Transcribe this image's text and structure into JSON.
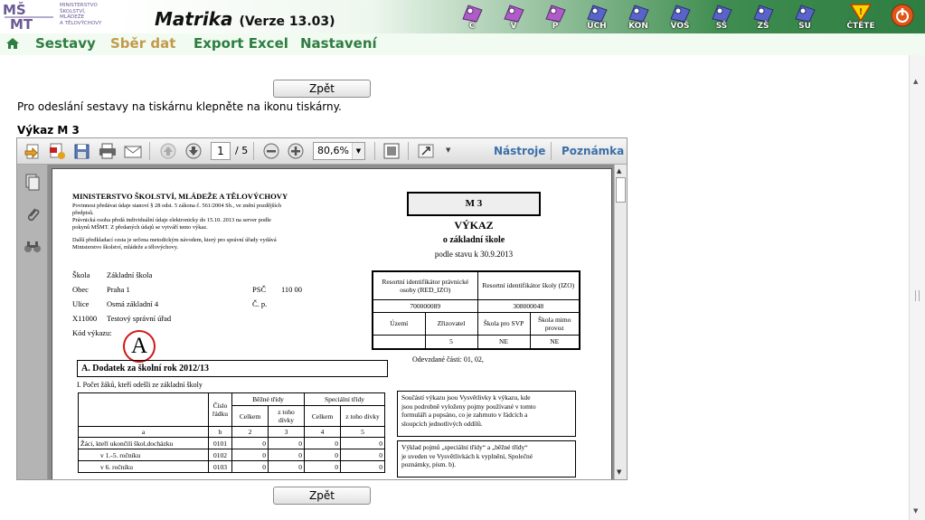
{
  "header": {
    "logo_lines": [
      "MINISTERSTVO",
      "ŠKOLSTVÍ,",
      "MLÁDEŽE",
      "A TĚLOVÝCHOVY"
    ],
    "app_name": "Matrika",
    "app_version": "(Verze 13.03)",
    "icons": [
      {
        "label": "C",
        "name": "module-c-icon"
      },
      {
        "label": "V",
        "name": "module-v-icon"
      },
      {
        "label": "P",
        "name": "module-p-icon"
      },
      {
        "label": "UCH",
        "name": "module-uch-icon"
      },
      {
        "label": "KON",
        "name": "module-kon-icon"
      },
      {
        "label": "VOŠ",
        "name": "module-vos-icon"
      },
      {
        "label": "SŠ",
        "name": "module-ss-icon"
      },
      {
        "label": "ZŠ",
        "name": "module-zs-icon"
      },
      {
        "label": "SU",
        "name": "module-su-icon"
      }
    ],
    "read_label": "ČTĚTE"
  },
  "menu": {
    "items": [
      "Sestavy",
      "Sběr dat",
      "Export Excel",
      "Nastavení"
    ],
    "active": "Sběr dat"
  },
  "content": {
    "back_label": "Zpět",
    "info_text": "Pro odeslání sestavy na tiskárnu klepněte na ikonu tiskárny.",
    "report_title": "Výkaz M 3"
  },
  "viewer": {
    "page_current": "1",
    "page_total": "/ 5",
    "zoom": "80,6%",
    "tools_label": "Nástroje",
    "notes_label": "Poznámka"
  },
  "document": {
    "ministry": "MINISTERSTVO ŠKOLSTVÍ, MLÁDEŽE A TĚLOVÝCHOVY",
    "note_lines": [
      "Povinnost předávat údaje stanoví § 28 odst. 5 zákona č. 561/2004 Sb., ve znění pozdějších",
      "předpisů.",
      "Právnická osoba předá individuální údaje elektronicky do 15.10. 2013 na server podle",
      "pokynů MŠMT. Z předaných údajů se vytváří tento výkaz.",
      "",
      "Další předkladací cesta je určena metodickým návodem, který pro správní úřady vydává",
      "Ministerstvo školství, mládeže a tělovýchovy."
    ],
    "school_label": "Škola",
    "school_value": "Základní škola",
    "town_label": "Obec",
    "town_value": "Praha 1",
    "psc_label": "PSČ",
    "psc_value": "110 00",
    "street_label": "Ulice",
    "street_value": "Osmá základní 4",
    "cp_label": "Č. p.",
    "office_code": "X11000",
    "office_value": "Testový správní úřad",
    "report_code_label": "Kód výkazu:",
    "stamp": "A",
    "form_code": "M 3",
    "form_title": "VÝKAZ",
    "form_subtitle": "o základní škole",
    "form_date": "podle stavu k 30.9.2013",
    "id_table": {
      "head1": "Resortní identifikátor právnické osoby (RED_IZO)",
      "head2": "Resortní identifikátor školy (IZO)",
      "val1": "700000089",
      "val2": "308000048",
      "col_uzemi": "Území",
      "col_zrizovatel": "Zřizovatel",
      "col_svp": "Škola pro SVP",
      "col_mimo": "Škola mimo provoz",
      "v_uzemi": "",
      "v_zrizovatel": "5",
      "v_svp": "NE",
      "v_mimo": "NE"
    },
    "parts_sent": "Odevzdané části: 01, 02,",
    "section_a": "A. Dodatek za školní rok 2012/13",
    "section_i": "I. Počet žáků, kteří odešli ze základní školy",
    "main_table": {
      "h_cislo": "Číslo řádku",
      "h_bezne": "Běžné třídy",
      "h_specialni": "Speciální třídy",
      "h_celkem": "Celkem",
      "h_ztoho": "z toho dívky",
      "idx": [
        "a",
        "b",
        "2",
        "3",
        "4",
        "5"
      ],
      "rows": [
        {
          "label": "Žáci, kteří ukončili škol.docházku",
          "code": "0101",
          "v": [
            "0",
            "0",
            "0",
            "0"
          ]
        },
        {
          "label": "v 1.-5. ročníku",
          "code": "0102",
          "v": [
            "0",
            "0",
            "0",
            "0"
          ]
        },
        {
          "label": "v 6. ročníku",
          "code": "0103",
          "v": [
            "0",
            "0",
            "0",
            "0"
          ]
        }
      ]
    },
    "box1_lines": [
      "Součástí výkazu jsou Vysvětlivky k výkazu, kde",
      "jsou podrobně vyloženy pojmy používané v tomto",
      "formuláři a popsáno, co je zahrnuto v řádcích a",
      "sloupcích jednotlivých oddílů."
    ],
    "box2_lines": [
      "Výklad pojmů „speciální třídy“ a „běžné třídy“",
      "je uveden ve Vysvětlivkách k vyplnění, Společné",
      "poznámky, písm. b)."
    ]
  }
}
